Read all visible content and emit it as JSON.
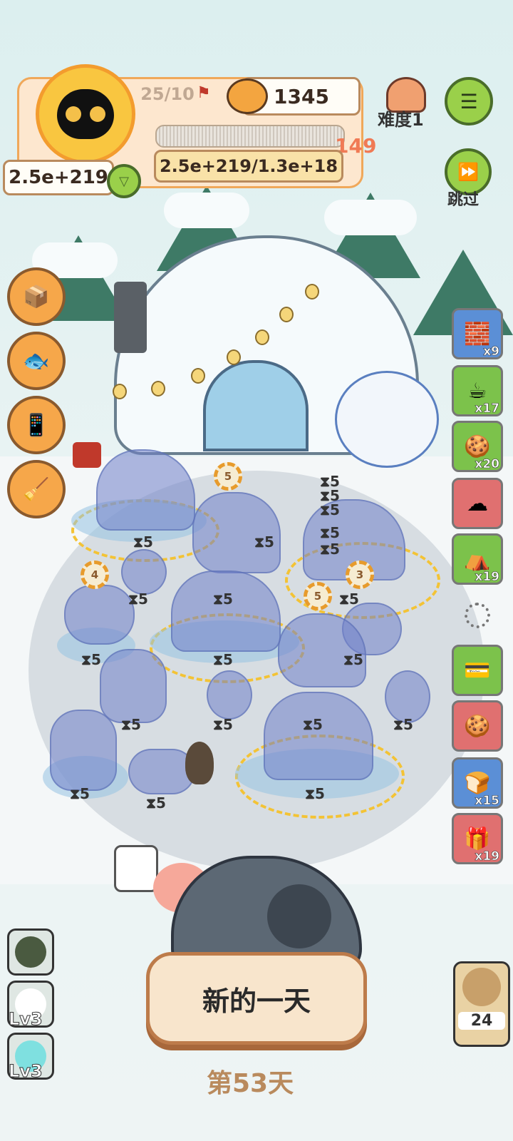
{
  "player": {
    "stage_progress": "25/10",
    "hp_value": "2.5e+219",
    "level": "149",
    "exp_text": "2.5e+219/1.3e+18"
  },
  "currency": {
    "coins": "1345"
  },
  "difficulty": {
    "label": "难度1"
  },
  "skip": {
    "label": "跳过"
  },
  "inventory": [
    {
      "icon": "fireplace-icon",
      "count": "x9",
      "color": "#5b8fd6"
    },
    {
      "icon": "coffee-cup-icon",
      "count": "x17",
      "color": "#7cc24b"
    },
    {
      "icon": "cookie-pack-icon",
      "count": "x20",
      "color": "#7cc24b"
    },
    {
      "icon": "cloud-creature-icon",
      "count": "",
      "color": "#e07070"
    },
    {
      "icon": "tent-icon",
      "count": "x19",
      "color": "#7cc24b"
    },
    {
      "icon": "bank-card-icon",
      "count": "",
      "color": "#7cc24b"
    },
    {
      "icon": "gingerbread-icon",
      "count": "",
      "color": "#e07070"
    },
    {
      "icon": "bread-icon",
      "count": "x15",
      "color": "#5b8fd6"
    },
    {
      "icon": "gift-bag-icon",
      "count": "x19",
      "color": "#e07070"
    }
  ],
  "board": {
    "timers": [
      "5",
      "5",
      "5",
      "5",
      "5",
      "5",
      "5",
      "5",
      "5",
      "5",
      "5",
      "5",
      "5",
      "5",
      "5",
      "5",
      "5",
      "5",
      "5",
      "5",
      "5",
      "5",
      "5",
      "5"
    ],
    "chips": [
      "5",
      "4",
      "3",
      "5"
    ]
  },
  "bottom": {
    "new_day_button": "新的一天",
    "day_label": "第53天",
    "skill_lv_1": "Lv3",
    "skill_lv_2": "Lv3",
    "owl_count": "24"
  }
}
